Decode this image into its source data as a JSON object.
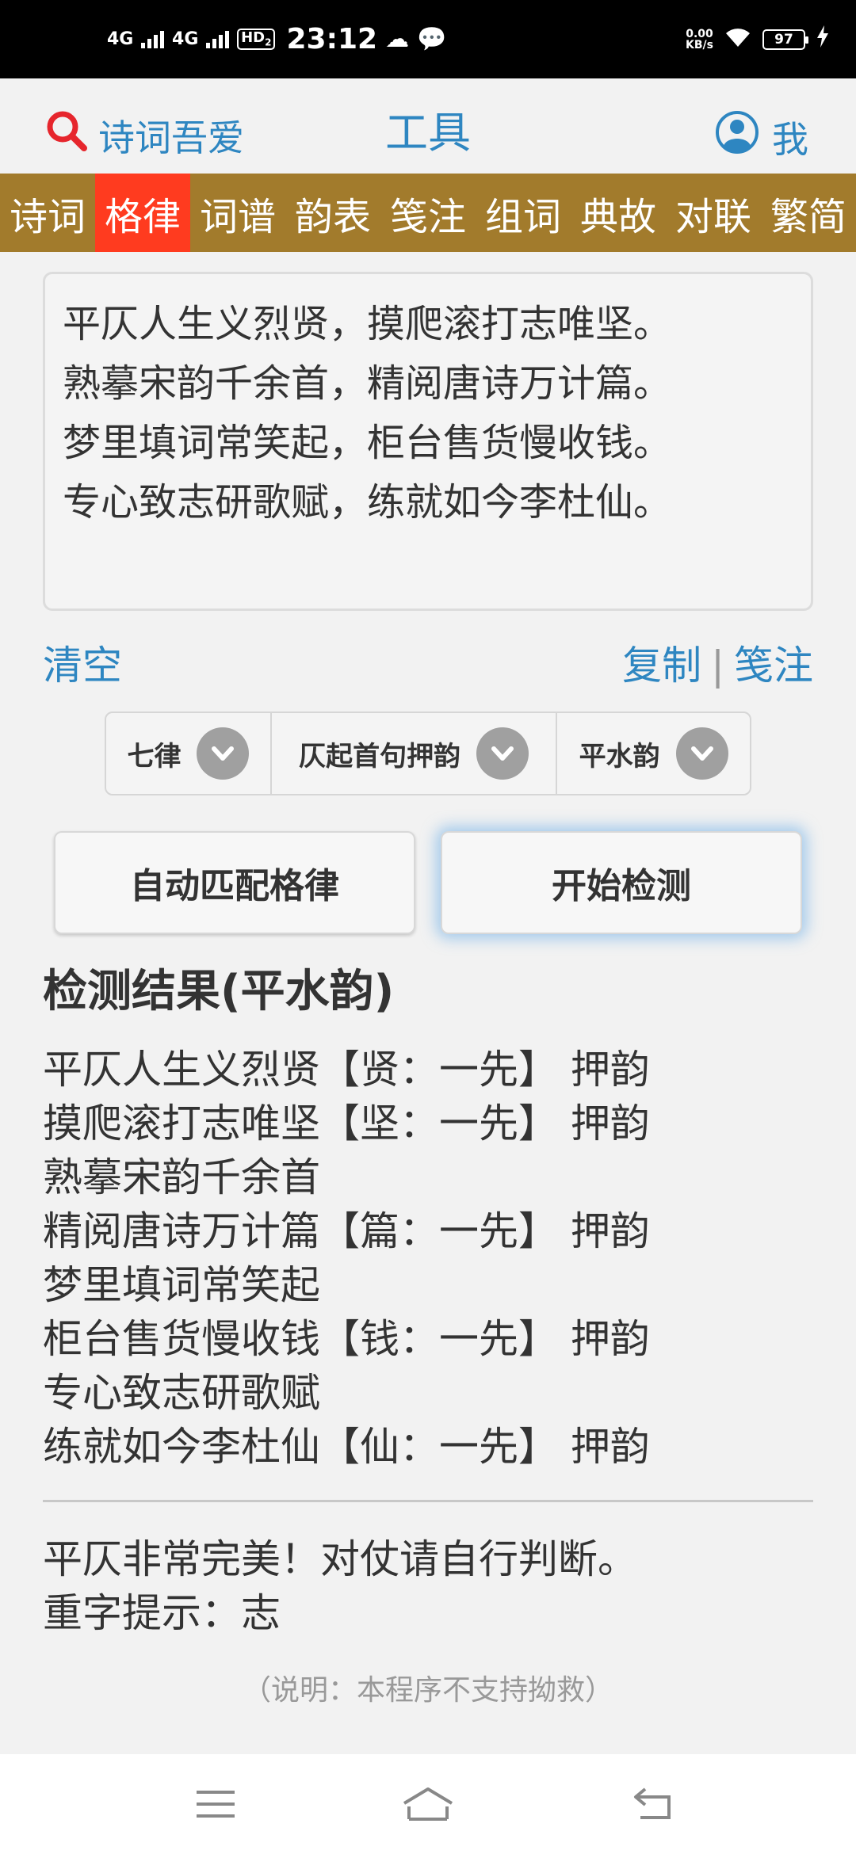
{
  "status": {
    "signal1": "4G",
    "signal2": "4G",
    "hd": "HD",
    "hd_sub": "2",
    "time": "23:12",
    "speed_value": "0.00",
    "speed_unit": "KB/s",
    "battery": "97"
  },
  "header": {
    "brand": "诗词吾爱",
    "title": "工具",
    "me": "我"
  },
  "categories": [
    "诗词",
    "格律",
    "词谱",
    "韵表",
    "笺注",
    "组词",
    "典故",
    "对联",
    "繁简"
  ],
  "active_category": "格律",
  "editor": {
    "lines": [
      "平仄人生义烈贤，摸爬滚打志唯坚。",
      "熟摹宋韵千余首，精阅唐诗万计篇。",
      "梦里填词常笑起，柜台售货慢收钱。",
      "专心致志研歌赋，练就如今李杜仙。"
    ]
  },
  "actions": {
    "clear": "清空",
    "copy": "复制",
    "separator": "|",
    "annotate": "笺注"
  },
  "selects": {
    "form": "七律",
    "rhyme_start": "仄起首句押韵",
    "rhyme_book": "平水韵"
  },
  "buttons": {
    "auto_match": "自动匹配格律",
    "start": "开始检测"
  },
  "results": {
    "title": "检测结果(平水韵)",
    "lines": [
      "平仄人生义烈贤【贤：一先】 押韵",
      "摸爬滚打志唯坚【坚：一先】 押韵",
      "熟摹宋韵千余首",
      "精阅唐诗万计篇【篇：一先】 押韵",
      "梦里填词常笑起",
      "柜台售货慢收钱【钱：一先】 押韵",
      "专心致志研歌赋",
      "练就如今李杜仙【仙：一先】 押韵"
    ],
    "summary1": "平仄非常完美！对仗请自行判断。",
    "summary2": "重字提示：志",
    "note": "（说明：本程序不支持拗救）"
  },
  "colors": {
    "accent": "#2e86c1",
    "nav_bg": "#a27b2c",
    "active_tab": "#ff3b1f",
    "search_icon": "#e6262d"
  }
}
